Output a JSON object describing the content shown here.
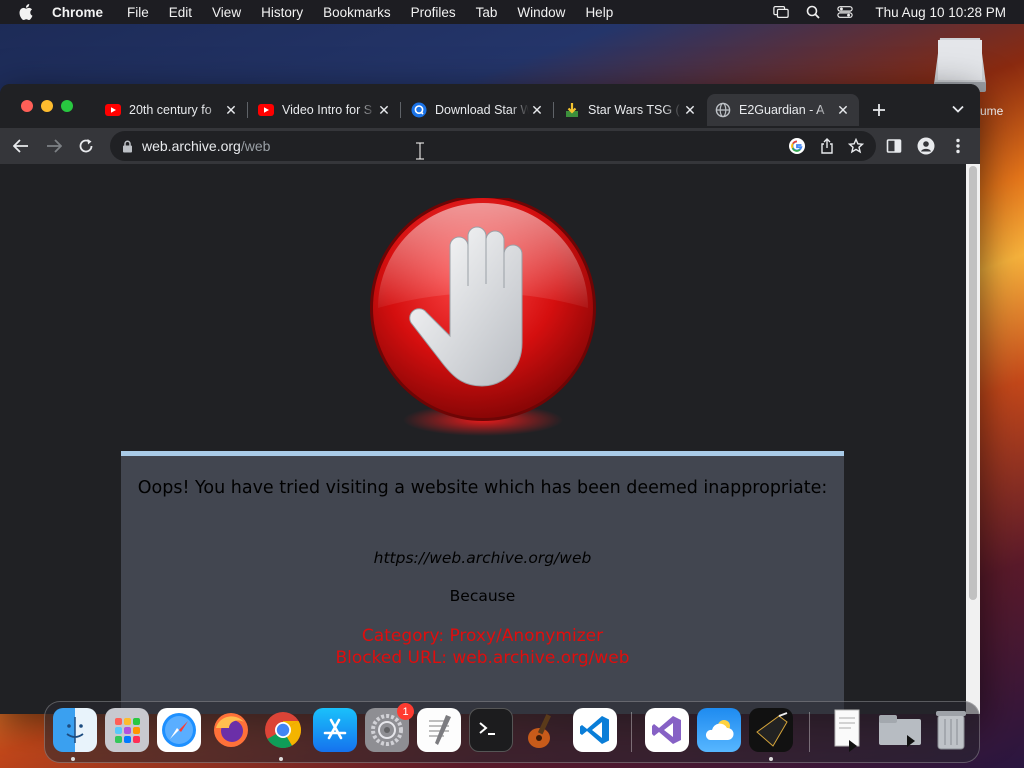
{
  "menubar": {
    "app": "Chrome",
    "items": [
      "File",
      "Edit",
      "View",
      "History",
      "Bookmarks",
      "Profiles",
      "Tab",
      "Window",
      "Help"
    ],
    "clock": "Thu Aug 10  10:28 PM"
  },
  "desktop": {
    "drive_label": "ume"
  },
  "tabs": [
    {
      "title": "20th century fo",
      "favicon": "youtube-icon"
    },
    {
      "title": "Video Intro for S",
      "favicon": "youtube-icon"
    },
    {
      "title": "Download Star W",
      "favicon": "search-q-icon"
    },
    {
      "title": "Star Wars TSG (",
      "favicon": "download-tray-icon"
    },
    {
      "title": "E2Guardian - A",
      "favicon": "globe-icon",
      "active": true
    }
  ],
  "omnibox": {
    "host": "web.archive.org",
    "path": "/web"
  },
  "page": {
    "heading": "Oops! You have tried visiting a website which has been deemed inappropriate:",
    "blocked_url": "https://web.archive.org/web",
    "because": "Because",
    "category": "Category: Proxy/Anonymizer",
    "blocked_line": "Blocked URL: web.archive.org/web"
  },
  "dock": {
    "apps": [
      "Finder",
      "Launchpad",
      "Safari",
      "Firefox",
      "Chrome",
      "App Store",
      "System Settings",
      "TextEdit",
      "Terminal",
      "GarageBand",
      "Visual Studio Code",
      "Visual Studio",
      "Weather",
      "Sketch",
      "Document",
      "Folder",
      "Trash"
    ],
    "settings_badge": "1"
  },
  "colors": {
    "accent_red": "#e00d0d",
    "panel_bg": "#424650",
    "panel_border": "#a9cbe8"
  }
}
